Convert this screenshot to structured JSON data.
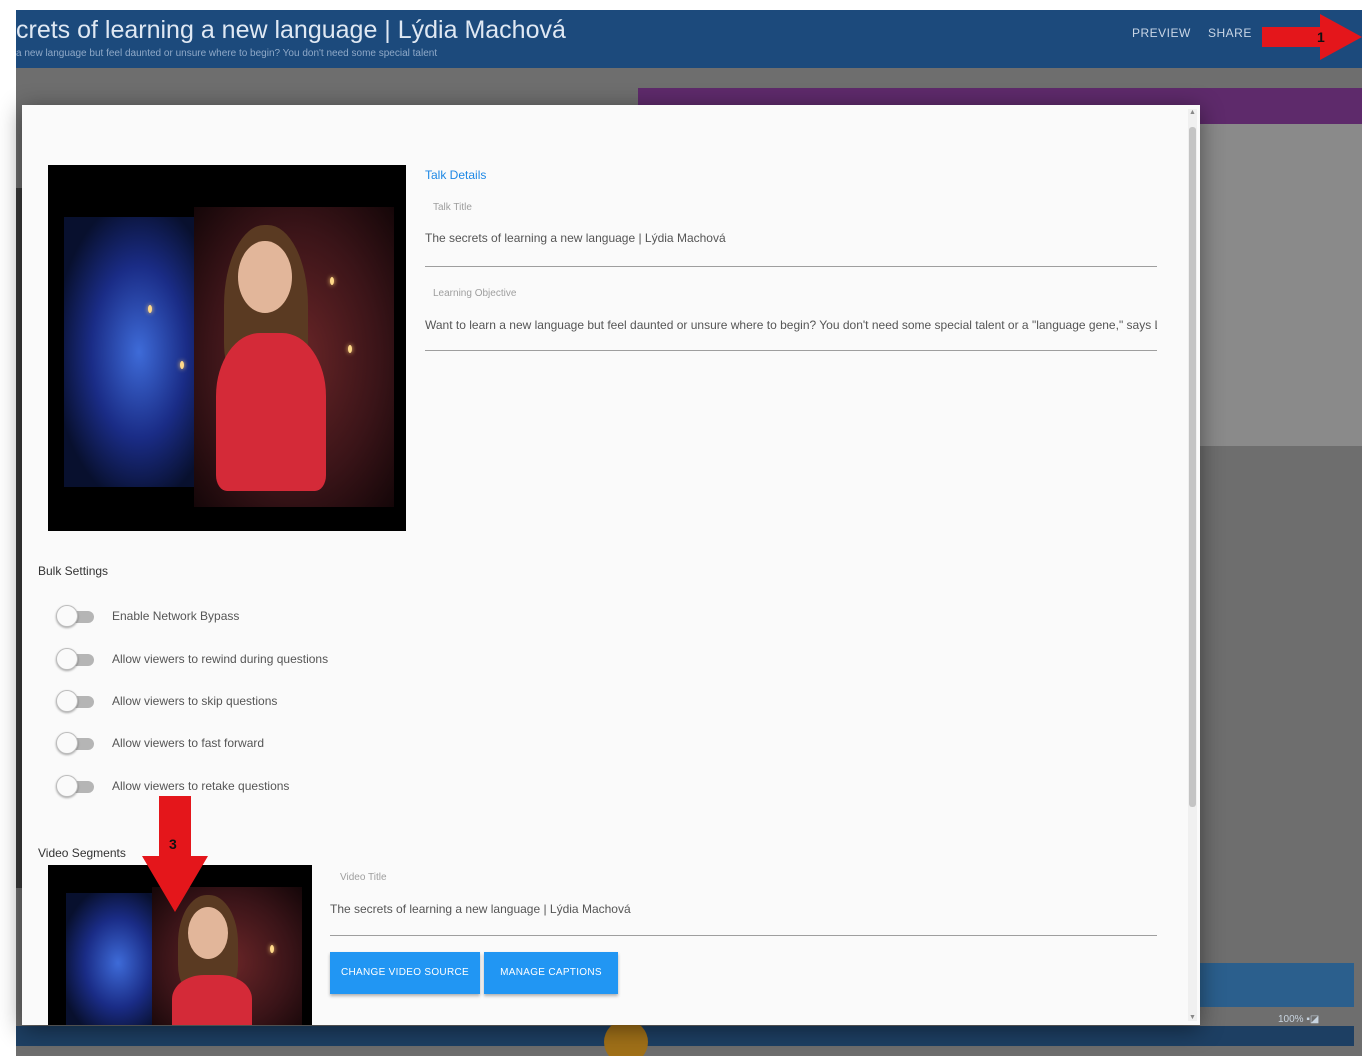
{
  "header": {
    "title": "crets of learning a new language | Lýdia Machová",
    "subtitle": "a new language but feel daunted or unsure where to begin? You don't need some special talent",
    "preview_label": "PREVIEW",
    "share_label": "SHARE"
  },
  "dialog": {
    "talk_details": {
      "heading": "Talk Details",
      "title_label": "Talk Title",
      "title_value": "The secrets of learning a new language | Lýdia Machová",
      "description_label": "Learning Objective",
      "description_value": "Want to learn a new language but feel daunted or unsure where to begin? You don't need some special talent or a \"language gene,\" says Lý"
    },
    "bulk_settings": {
      "heading": "Bulk Settings",
      "toggles": [
        {
          "label": "Enable Network Bypass",
          "on": false
        },
        {
          "label": "Allow viewers to rewind during questions",
          "on": false
        },
        {
          "label": "Allow viewers to skip questions",
          "on": false
        },
        {
          "label": "Allow viewers to fast forward",
          "on": false
        },
        {
          "label": "Allow viewers to retake questions",
          "on": false
        }
      ]
    },
    "video_segments": {
      "heading": "Video Segments",
      "video_title_label": "Video Title",
      "video_title_value": "The secrets of learning a new language | Lýdia Machová",
      "change_video_label": "CHANGE VIDEO SOURCE",
      "manage_captions_label": "MANAGE CAPTIONS"
    }
  },
  "background": {
    "zoom_text": "100% ▪◪"
  },
  "annotations": {
    "arrow_1_number": "1",
    "arrow_3_number": "3",
    "arrow_color": "#e4161b"
  },
  "colors": {
    "header_bg": "#1c4a7c",
    "accent_blue": "#2196f3",
    "heading_blue": "#1e88e5",
    "purple_bar": "#5e2a6b"
  }
}
